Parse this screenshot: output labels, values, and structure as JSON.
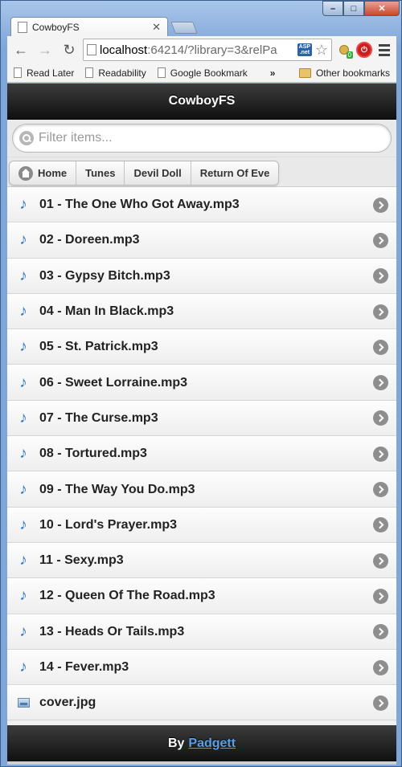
{
  "browser": {
    "tab_title": "CowboyFS",
    "url_host": "localhost",
    "url_rest": ":64214/?library=3&relPa",
    "bookmarks": [
      "Read Later",
      "Readability",
      "Google Bookmark"
    ],
    "bookmarks_overflow": "»",
    "other_bookmarks": "Other bookmarks",
    "ext_badge": "0"
  },
  "app": {
    "title": "CowboyFS",
    "search_placeholder": "Filter items...",
    "breadcrumbs": [
      "Home",
      "Tunes",
      "Devil Doll",
      "Return Of Eve"
    ],
    "items": [
      {
        "label": "01 - The One Who Got Away.mp3",
        "icon": "music-note-icon"
      },
      {
        "label": "02 - Doreen.mp3",
        "icon": "music-note-icon"
      },
      {
        "label": "03 - Gypsy Bitch.mp3",
        "icon": "music-note-icon"
      },
      {
        "label": "04 - Man In Black.mp3",
        "icon": "music-note-icon"
      },
      {
        "label": "05 - St. Patrick.mp3",
        "icon": "music-note-icon"
      },
      {
        "label": "06 - Sweet Lorraine.mp3",
        "icon": "music-note-icon"
      },
      {
        "label": "07 - The Curse.mp3",
        "icon": "music-note-icon"
      },
      {
        "label": "08 - Tortured.mp3",
        "icon": "music-note-icon"
      },
      {
        "label": "09 - The Way You Do.mp3",
        "icon": "music-note-icon"
      },
      {
        "label": "10 - Lord's Prayer.mp3",
        "icon": "music-note-icon"
      },
      {
        "label": "11 - Sexy.mp3",
        "icon": "music-note-icon"
      },
      {
        "label": "12 - Queen Of The Road.mp3",
        "icon": "music-note-icon"
      },
      {
        "label": "13 - Heads Or Tails.mp3",
        "icon": "music-note-icon"
      },
      {
        "label": "14 - Fever.mp3",
        "icon": "music-note-icon"
      },
      {
        "label": "cover.jpg",
        "icon": "image-file-icon"
      }
    ],
    "footer_prefix": "By",
    "footer_link": "Padgett"
  }
}
